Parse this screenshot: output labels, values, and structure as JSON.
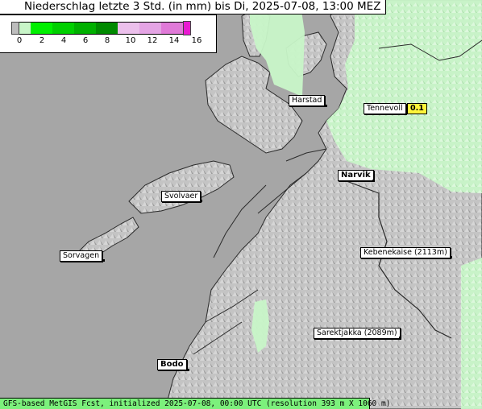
{
  "title": "Niederschlag letzte 3 Std. (in mm) bis Di, 2025-07-08, 13:00 MEZ",
  "legend": {
    "ticks": [
      "0",
      "2",
      "4",
      "6",
      "8",
      "10",
      "12",
      "14",
      "16"
    ],
    "colors": [
      "#c8f5c8",
      "#00ff00",
      "#00d000",
      "#00b000",
      "#009000",
      "#e8b4e8",
      "#e0a0e0",
      "#e070d8",
      "#e91ad1"
    ]
  },
  "places": [
    {
      "name": "Harstad"
    },
    {
      "name": "Tennevoll",
      "value": "0.1"
    },
    {
      "name": "Narvik"
    },
    {
      "name": "Svolvaer"
    },
    {
      "name": "Sorvagen"
    },
    {
      "name": "Kebenekaise (2113m)"
    },
    {
      "name": "Sarektjakka (2089m)"
    },
    {
      "name": "Bodo"
    }
  ],
  "footer": "GFS-based MetGIS Fcst, initialized 2025-07-08, 00:00 UTC  (resolution 393 m X 1060 m)",
  "colors": {
    "sea": "#a6a6a6",
    "land": "#c9c9c9",
    "precip_light": "#c8f5c8",
    "coast": "#2a2a2a"
  }
}
